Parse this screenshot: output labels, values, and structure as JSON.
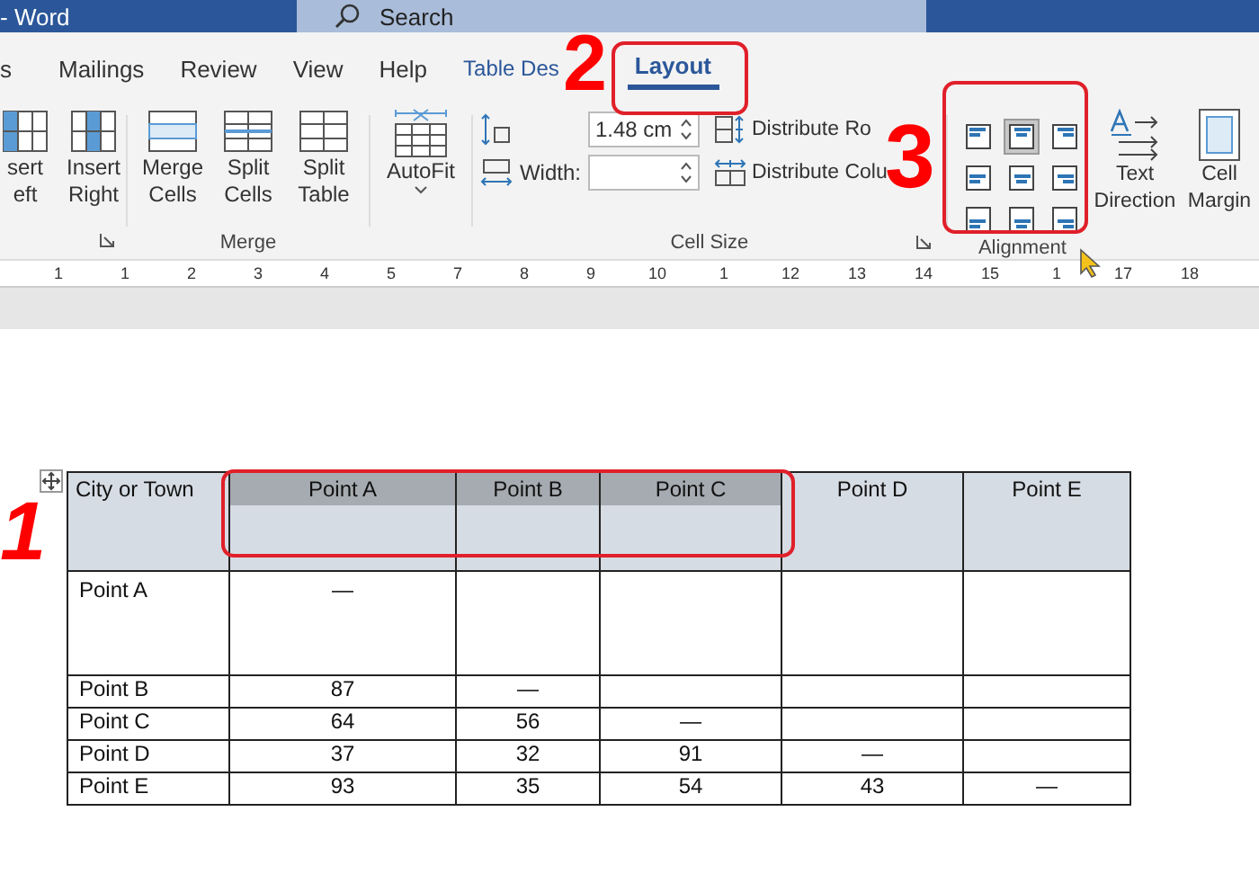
{
  "window": {
    "title": "- Word",
    "search_placeholder": "Search"
  },
  "tabs": [
    {
      "label": "s",
      "selected": false
    },
    {
      "label": "Mailings",
      "selected": false
    },
    {
      "label": "Review",
      "selected": false
    },
    {
      "label": "View",
      "selected": false
    },
    {
      "label": "Help",
      "selected": false
    },
    {
      "label": "Table Des",
      "selected": false
    },
    {
      "label": "Layout",
      "selected": true
    }
  ],
  "ribbon": {
    "insert_buttons": [
      "sert eft",
      "Insert Right"
    ],
    "merge_group": {
      "buttons": [
        "Merge Cells",
        "Split Cells",
        "Split Table"
      ],
      "label": "Merge"
    },
    "autofit": "AutoFit",
    "cell_size": {
      "height_value": "1.48 cm",
      "width_label": "Width:",
      "distribute_rows": "Distribute Ro",
      "distribute_columns": "Distribute Colu",
      "label": "Cell Size"
    },
    "alignment": {
      "cells": [
        {
          "selected": false
        },
        {
          "selected": true
        },
        {
          "selected": false
        },
        {
          "selected": false
        },
        {
          "selected": false
        },
        {
          "selected": false
        },
        {
          "selected": false
        },
        {
          "selected": false
        },
        {
          "selected": false
        }
      ],
      "label": "Alignment"
    },
    "text_direction": "Text Direction",
    "cell_margins": "Cell Margin"
  },
  "ruler": [
    "1",
    "1",
    "2",
    "3",
    "4",
    "5",
    "7",
    "8",
    "9",
    "10",
    "1",
    "12",
    "13",
    "14",
    "15",
    "1",
    "17",
    "18"
  ],
  "table": {
    "columns": [
      {
        "label": "City or Town",
        "selected": false
      },
      {
        "label": "Point A",
        "selected": true
      },
      {
        "label": "Point B",
        "selected": true
      },
      {
        "label": "Point C",
        "selected": true
      },
      {
        "label": "Point D",
        "selected": false
      },
      {
        "label": "Point E",
        "selected": false
      }
    ],
    "rows": [
      [
        "Point A",
        "—",
        "",
        "",
        "",
        ""
      ],
      [
        "Point B",
        "87",
        "—",
        "",
        "",
        ""
      ],
      [
        "Point C",
        "64",
        "56",
        "—",
        "",
        ""
      ],
      [
        "Point D",
        "37",
        "32",
        "91",
        "—",
        ""
      ],
      [
        "Point E",
        "93",
        "35",
        "54",
        "43",
        "—"
      ]
    ]
  },
  "annotations": [
    "1",
    "2",
    "3"
  ]
}
